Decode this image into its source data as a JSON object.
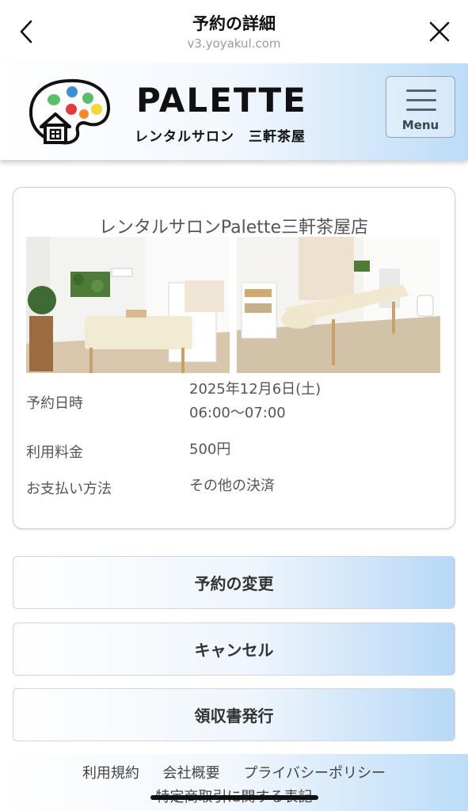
{
  "topbar": {
    "title": "予約の詳細",
    "url": "v3.yoyakul.com"
  },
  "header": {
    "brand": "PALETTE",
    "subtitle": "レンタルサロン　三軒茶屋",
    "menu_label": "Menu"
  },
  "reservation": {
    "store_name": "レンタルサロンPalette三軒茶屋店",
    "rows": [
      {
        "label": "予約日時",
        "value_line1": "2025年12月6日(土)",
        "value_line2": "06:00～07:00"
      },
      {
        "label": "利用料金",
        "value_line1": "500円"
      },
      {
        "label": "お支払い方法",
        "value_line1": "その他の決済"
      }
    ]
  },
  "actions": {
    "change": "予約の変更",
    "cancel": "キャンセル",
    "receipt": "領収書発行"
  },
  "footer": {
    "terms": "利用規約",
    "company": "会社概要",
    "privacy": "プライバシーポリシー",
    "commerce": "特定商取引に関する表記"
  },
  "colors": {
    "header_gradient_end": "#bcdcf7",
    "button_gradient_end": "#b7d8f6",
    "logo_blue": "#3b8fd8",
    "logo_green": "#58c06a",
    "logo_red": "#e23b3b",
    "logo_yellow": "#f5d63a",
    "logo_orange": "#f08a2a"
  }
}
